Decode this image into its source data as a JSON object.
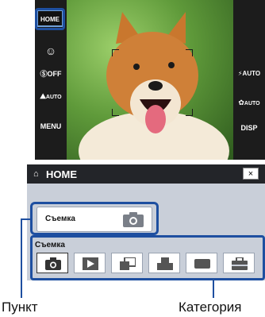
{
  "camera": {
    "home_label": "HOME",
    "smile_icon": "smile-shutter-icon",
    "self_timer_label": "ⓈOFF",
    "scene_label": "AUTO",
    "menu_label": "MENU",
    "flash_label": "⚡AUTO",
    "macro_label": "AUTO",
    "disp_label": "DISP"
  },
  "panel": {
    "title": "HOME",
    "close_label": "×",
    "item_label": "Съемка",
    "category_label": "Съемка",
    "categories": [
      "camera-icon",
      "playback-icon",
      "slideshow-icon",
      "print-icon",
      "memory-icon",
      "settings-icon"
    ]
  },
  "captions": {
    "item": "Пункт",
    "category": "Категория"
  },
  "colors": {
    "accent": "#1e4fa0",
    "panel_bg": "#c9cfd9",
    "header_bg": "#232529"
  }
}
